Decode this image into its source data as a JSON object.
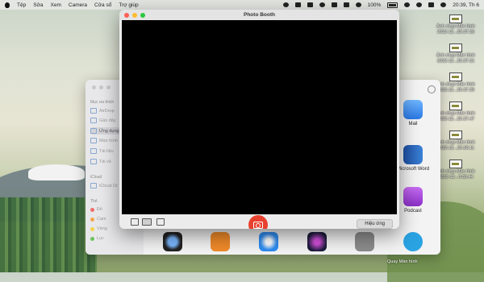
{
  "menubar": {
    "items": [
      "Tệp",
      "Sửa",
      "Xem",
      "Camera",
      "Cửa sổ",
      "Trợ giúp"
    ],
    "battery": "100%",
    "datetime": "20:39, Th 6"
  },
  "desktop": {
    "screenshots": [
      {
        "line1": "Ảnh chụp Màn hình",
        "line2": "2022-12...20.37.26"
      },
      {
        "line1": "Ảnh chụp Màn hình",
        "line2": "2022-12...20.37.31"
      },
      {
        "line1": "Ảnh chụp Màn hình",
        "line2": "2022-12...20.37.39"
      },
      {
        "line1": "Ảnh chụp Màn hình",
        "line2": "2022-12...20.37.47"
      },
      {
        "line1": "Ảnh chụp Màn hình",
        "line2": "2022-12...20.38.11"
      },
      {
        "line1": "Ảnh chụp Màn hình",
        "line2": "2022-12...0.38.44"
      }
    ],
    "bottom_label": "Quay Màn hình"
  },
  "finder": {
    "sections": {
      "favorites": "Mục ưa thích",
      "icloud": "iCloud",
      "tags": "Thẻ"
    },
    "items": [
      "AirDrop",
      "Gần đây",
      "Ứng dụng",
      "Màn hình",
      "Tài liệu",
      "Tải về"
    ],
    "icloud_items": [
      "iCloud Dr"
    ],
    "tags": [
      "Đỏ",
      "Cam",
      "Vàng",
      "Lục"
    ],
    "apps": [
      {
        "label": "Mail"
      },
      {
        "label": "Microsoft Word"
      },
      {
        "label": "Podcast"
      }
    ]
  },
  "photobooth": {
    "title": "Photo Booth",
    "effects_label": "Hiệu ứng"
  },
  "colors": {
    "shutter": "#e8412f",
    "close": "#fe5f57",
    "minimize": "#febc2e",
    "zoom": "#28c840"
  }
}
